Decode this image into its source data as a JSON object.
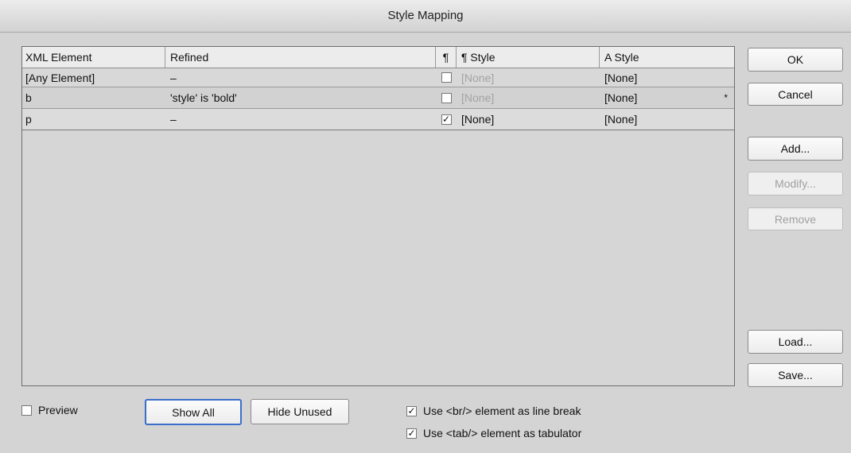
{
  "window": {
    "title": "Style Mapping"
  },
  "table": {
    "headers": {
      "xml_element": "XML Element",
      "refined": "Refined",
      "pilcrow": "¶",
      "para_style": "¶  Style",
      "char_style": "A  Style"
    },
    "rows": [
      {
        "element": "[Any Element]",
        "refined": "–",
        "checked": false,
        "para_style": "[None]",
        "char_style": "[None]",
        "mark": ""
      },
      {
        "element": "b",
        "refined": "'style' is 'bold'",
        "checked": false,
        "para_style": "[None]",
        "char_style": "[None]",
        "mark": "*"
      },
      {
        "element": "p",
        "refined": "–",
        "checked": true,
        "para_style": "[None]",
        "char_style": "[None]",
        "mark": ""
      }
    ]
  },
  "buttons": {
    "ok": "OK",
    "cancel": "Cancel",
    "add": "Add...",
    "modify": "Modify...",
    "remove": "Remove",
    "load": "Load...",
    "save": "Save...",
    "show_all": "Show All",
    "hide_unused": "Hide Unused"
  },
  "options": {
    "preview": {
      "label": "Preview",
      "checked": false
    },
    "br_line_break": {
      "label": "Use <br/> element as line break",
      "checked": true
    },
    "tab_tabulator": {
      "label": "Use <tab/> element as tabulator",
      "checked": true
    }
  },
  "glyphs": {
    "check": "✓"
  }
}
